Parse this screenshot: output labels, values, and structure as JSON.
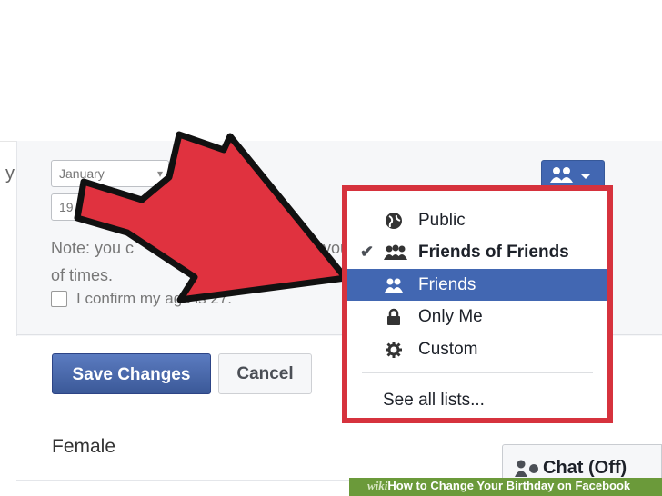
{
  "birthday": {
    "left_label_fragment": "y",
    "month_value": "January",
    "year_value": "19",
    "note_text": "Note: you c",
    "note_line2": "of times.",
    "note_right_fragment": "you",
    "confirm_text": "I confirm my age is 27."
  },
  "actions": {
    "save_label": "Save Changes",
    "cancel_label": "Cancel"
  },
  "gender_value": "Female",
  "audience_menu": {
    "items": [
      {
        "label": "Public",
        "icon": "globe-icon",
        "checked": false,
        "selected": false
      },
      {
        "label": "Friends of Friends",
        "icon": "friends-of-friends-icon",
        "checked": true,
        "selected": false
      },
      {
        "label": "Friends",
        "icon": "friends-icon",
        "checked": false,
        "selected": true
      },
      {
        "label": "Only Me",
        "icon": "lock-icon",
        "checked": false,
        "selected": false
      },
      {
        "label": "Custom",
        "icon": "gear-icon",
        "checked": false,
        "selected": false
      }
    ],
    "see_all_label": "See all lists..."
  },
  "chat": {
    "label": "Chat (Off)"
  },
  "footer": {
    "wiki": "wiki",
    "title": "How to Change Your Birthday on Facebook"
  },
  "colors": {
    "facebook_blue": "#4267b2",
    "highlight_red": "#d6323d",
    "arrow_red": "#e0323f"
  }
}
